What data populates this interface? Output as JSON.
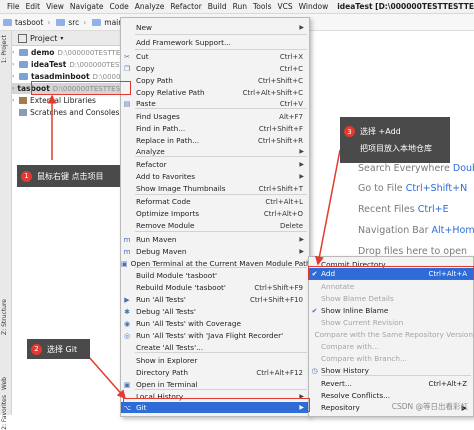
{
  "menubar": {
    "items": [
      "File",
      "Edit",
      "View",
      "Navigate",
      "Code",
      "Analyze",
      "Refactor",
      "Build",
      "Run",
      "Tools",
      "VCS",
      "Window"
    ],
    "title": "ideaTest [D:\\000000TESTTESTTEST"
  },
  "breadcrumbs": [
    "tasboot",
    "src",
    "main",
    "ja"
  ],
  "tool_strip": {
    "top_tab": "1: Project",
    "bottom_tabs": [
      "Z: Structure",
      "Web",
      "2: Favorites"
    ]
  },
  "project_panel": {
    "header": "Project",
    "tree": [
      {
        "name": "demo",
        "path": "D:\\000000TESTTESTTEST"
      },
      {
        "name": "ideaTest",
        "path": "D:\\000000TESTTESTT"
      },
      {
        "name": "tasadminboot",
        "path": "D:\\000000TESTTE"
      },
      {
        "name": "tasboot",
        "path": "D:\\000000TESTTESTTES"
      },
      {
        "name": "External Libraries",
        "path": ""
      },
      {
        "name": "Scratches and Consoles",
        "path": ""
      }
    ]
  },
  "context_menu": {
    "items": [
      {
        "label": "New",
        "shortcut": "",
        "icon": ""
      },
      {
        "label": "Add Framework Support...",
        "shortcut": "",
        "icon": ""
      },
      {
        "label": "Cut",
        "shortcut": "Ctrl+X",
        "icon": "cut-icon"
      },
      {
        "label": "Copy",
        "shortcut": "Ctrl+C",
        "icon": "copy-icon"
      },
      {
        "label": "Copy Path",
        "shortcut": "Ctrl+Shift+C",
        "icon": ""
      },
      {
        "label": "Copy Relative Path",
        "shortcut": "Ctrl+Alt+Shift+C",
        "icon": ""
      },
      {
        "label": "Paste",
        "shortcut": "Ctrl+V",
        "icon": "paste-icon"
      },
      {
        "label": "Find Usages",
        "shortcut": "Alt+F7",
        "icon": ""
      },
      {
        "label": "Find in Path...",
        "shortcut": "Ctrl+Shift+F",
        "icon": ""
      },
      {
        "label": "Replace in Path...",
        "shortcut": "Ctrl+Shift+R",
        "icon": ""
      },
      {
        "label": "Analyze",
        "shortcut": "",
        "icon": ""
      },
      {
        "label": "Refactor",
        "shortcut": "",
        "icon": ""
      },
      {
        "label": "Add to Favorites",
        "shortcut": "",
        "icon": ""
      },
      {
        "label": "Show Image Thumbnails",
        "shortcut": "Ctrl+Shift+T",
        "icon": ""
      },
      {
        "label": "Reformat Code",
        "shortcut": "Ctrl+Alt+L",
        "icon": ""
      },
      {
        "label": "Optimize Imports",
        "shortcut": "Ctrl+Alt+O",
        "icon": ""
      },
      {
        "label": "Remove Module",
        "shortcut": "Delete",
        "icon": ""
      },
      {
        "label": "Run Maven",
        "shortcut": "",
        "icon": "maven-icon"
      },
      {
        "label": "Debug Maven",
        "shortcut": "",
        "icon": "maven-debug-icon"
      },
      {
        "label": "Open Terminal at the Current Maven Module Path",
        "shortcut": "",
        "icon": "terminal-icon"
      },
      {
        "label": "Build Module 'tasboot'",
        "shortcut": "",
        "icon": ""
      },
      {
        "label": "Rebuild Module 'tasboot'",
        "shortcut": "Ctrl+Shift+F9",
        "icon": ""
      },
      {
        "label": "Run 'All Tests'",
        "shortcut": "Ctrl+Shift+F10",
        "icon": "run-icon"
      },
      {
        "label": "Debug 'All Tests'",
        "shortcut": "",
        "icon": "debug-icon"
      },
      {
        "label": "Run 'All Tests' with Coverage",
        "shortcut": "",
        "icon": "coverage-icon"
      },
      {
        "label": "Run 'All Tests' with 'Java Flight Recorder'",
        "shortcut": "",
        "icon": "profiler-icon"
      },
      {
        "label": "Create 'All Tests'...",
        "shortcut": "",
        "icon": ""
      },
      {
        "label": "Show in Explorer",
        "shortcut": "",
        "icon": ""
      },
      {
        "label": "Directory Path",
        "shortcut": "Ctrl+Alt+F12",
        "icon": ""
      },
      {
        "label": "Open in Terminal",
        "shortcut": "",
        "icon": "terminal-icon"
      },
      {
        "label": "Local History",
        "shortcut": "",
        "icon": ""
      },
      {
        "label": "Git",
        "shortcut": "",
        "icon": "git-icon"
      }
    ]
  },
  "git_submenu": {
    "items": [
      {
        "label": "Commit Directory...",
        "shortcut": "",
        "disabled": false
      },
      {
        "label": "Add",
        "shortcut": "Ctrl+Alt+A",
        "disabled": false
      },
      {
        "label": "Annotate",
        "shortcut": "",
        "disabled": true
      },
      {
        "label": "Show Blame Details",
        "shortcut": "",
        "disabled": true
      },
      {
        "label": "Show Inline Blame",
        "shortcut": "",
        "disabled": false
      },
      {
        "label": "Show Current Revision",
        "shortcut": "",
        "disabled": true
      },
      {
        "label": "Compare with the Same Repository Version",
        "shortcut": "",
        "disabled": true
      },
      {
        "label": "Compare with...",
        "shortcut": "",
        "disabled": true
      },
      {
        "label": "Compare with Branch...",
        "shortcut": "",
        "disabled": true
      },
      {
        "label": "Show History",
        "shortcut": "",
        "disabled": false
      },
      {
        "label": "Revert...",
        "shortcut": "Ctrl+Alt+Z",
        "disabled": false
      },
      {
        "label": "Resolve Conflicts...",
        "shortcut": "",
        "disabled": false
      },
      {
        "label": "Repository",
        "shortcut": "",
        "disabled": false
      }
    ]
  },
  "editor_hints": [
    {
      "text": "Search Everywhere",
      "key": "Double"
    },
    {
      "text": "Go to File",
      "key": "Ctrl+Shift+N"
    },
    {
      "text": "Recent Files",
      "key": "Ctrl+E"
    },
    {
      "text": "Navigation Bar",
      "key": "Alt+Home"
    },
    {
      "text": "Drop files here to open",
      "key": ""
    }
  ],
  "annotations": {
    "step1": {
      "num": "1",
      "text": "鼠标右键 点击项目"
    },
    "step2": {
      "num": "2",
      "text": "选择 Git"
    },
    "step3": {
      "num": "3",
      "text": "选择 +Add",
      "subtext": "把项目放入本地仓库"
    }
  },
  "watermark": "CSDN @等日出看彩虹",
  "colors": {
    "selection": "#2e6bd6",
    "annotation_red": "#e23a2e",
    "callout_bg": "#4a4a4a"
  }
}
